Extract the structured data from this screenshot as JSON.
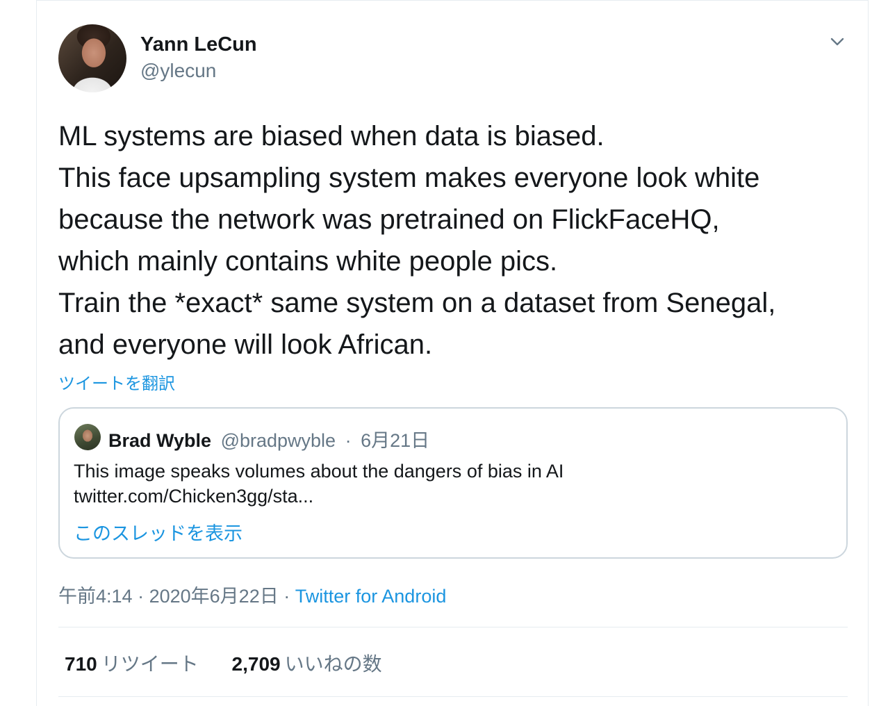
{
  "author": {
    "name": "Yann LeCun",
    "handle": "@ylecun"
  },
  "tweet": {
    "lines": [
      "ML systems are biased when data is biased.",
      "This face upsampling system makes everyone look white",
      "because the network was pretrained on FlickFaceHQ,",
      "which mainly contains white people pics.",
      "Train the *exact* same system on a dataset from Senegal,",
      "and everyone will look African."
    ],
    "translate_label": "ツイートを翻訳"
  },
  "quoted": {
    "name": "Brad Wyble",
    "handle": "@bradpwyble",
    "separator": "·",
    "date": "6月21日",
    "text_line1": "This image speaks volumes about the dangers of bias in AI",
    "text_line2": "twitter.com/Chicken3gg/sta...",
    "thread_label": "このスレッドを表示"
  },
  "meta": {
    "time": "午前4:14",
    "separator": "·",
    "date": "2020年6月22日",
    "source": "Twitter for Android"
  },
  "stats": {
    "retweets_count": "710",
    "retweets_label": "リツイート",
    "likes_count": "2,709",
    "likes_label": "いいねの数"
  },
  "colors": {
    "link": "#1b95e0",
    "secondary_text": "#657786",
    "border": "#ccd6dd"
  },
  "icons": {
    "menu": "chevron-down-icon"
  }
}
